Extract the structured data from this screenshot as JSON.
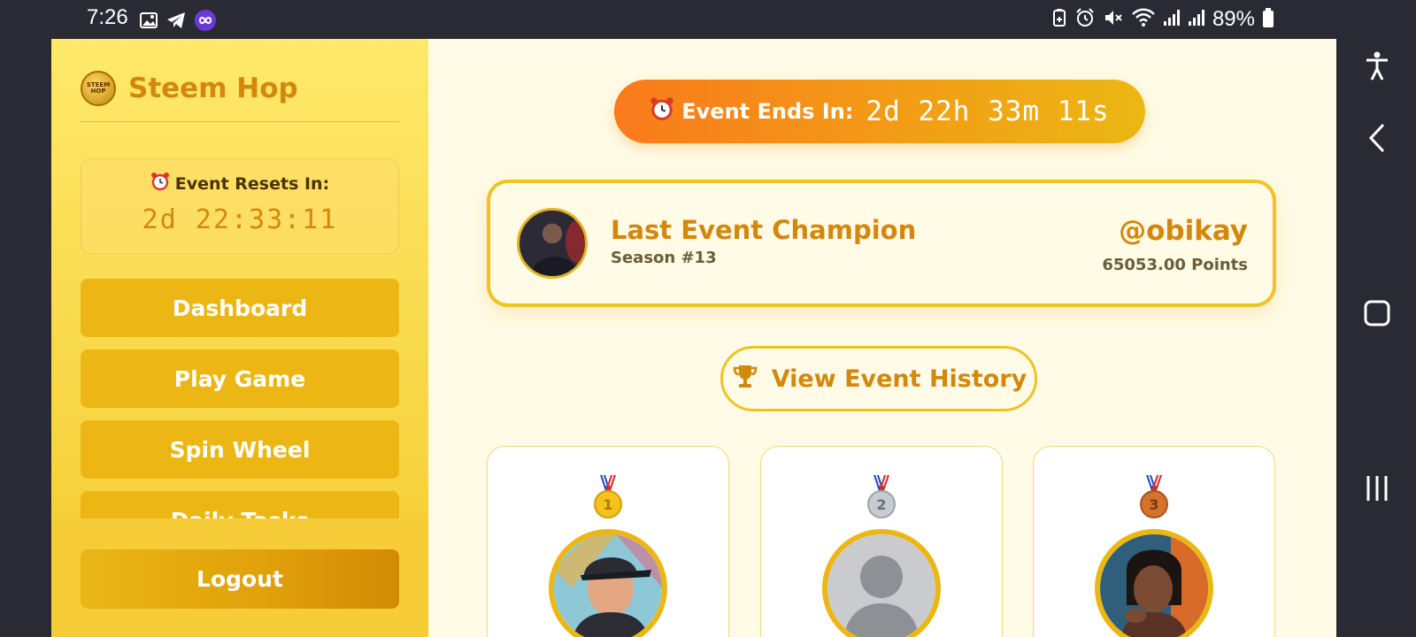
{
  "status_bar": {
    "time": "7:26",
    "battery": "89%"
  },
  "sidebar": {
    "brand": "Steem Hop",
    "logo_text": "STEEM HOP",
    "reset_title": "Event Resets In:",
    "reset_time": "2d 22:33:11",
    "menu": [
      {
        "label": "Dashboard"
      },
      {
        "label": "Play Game"
      },
      {
        "label": "Spin Wheel"
      },
      {
        "label": "Daily Tasks"
      }
    ],
    "logout": "Logout"
  },
  "main": {
    "timer_label": "Event Ends In:",
    "timer_value": "2d 22h 33m 11s",
    "champion": {
      "title": "Last Event Champion",
      "season": "Season #13",
      "username": "@obikay",
      "points": "65053.00 Points"
    },
    "history_button": "View Event History",
    "podium": [
      {
        "rank": "1",
        "medal_color": "#f3c21b"
      },
      {
        "rank": "2",
        "medal_color": "#b8bcc4"
      },
      {
        "rank": "3",
        "medal_color": "#d3742a"
      }
    ]
  },
  "colors": {
    "accent": "#d4870d",
    "gold": "#ecb714",
    "orange": "#fa7a1c",
    "background": "#fffbe6"
  }
}
